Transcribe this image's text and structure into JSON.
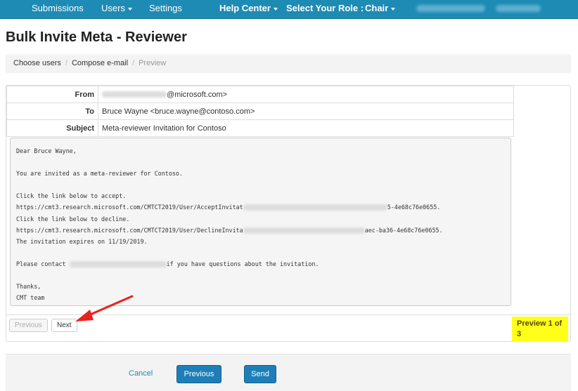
{
  "nav": {
    "submissions": "Submissions",
    "users": "Users",
    "settings": "Settings",
    "help_center": "Help Center",
    "role_label": "Select Your Role :",
    "role_value": "Chair"
  },
  "page": {
    "title": "Bulk Invite Meta - Reviewer"
  },
  "breadcrumb": {
    "step1": "Choose users",
    "step2": "Compose e-mail",
    "step3": "Preview"
  },
  "email": {
    "from_label": "From",
    "from_value": "@microsoft.com>",
    "to_label": "To",
    "to_value": "Bruce Wayne <bruce.wayne@contoso.com>",
    "subject_label": "Subject",
    "subject_value": "Meta-reviewer Invitation for Contoso",
    "body": {
      "l1": "Dear Bruce Wayne,",
      "l2": "You are invited as a meta-reviewer for Contoso.",
      "l3": "Click the link below to accept.",
      "l4a": "https://cmt3.research.microsoft.com/CMTCT2019/User/AcceptInvitat",
      "l4b": "5-4e68c76e0655.",
      "l5": "Click the link below to decline.",
      "l6a": "https://cmt3.research.microsoft.com/CMTCT2019/User/DeclineInvita",
      "l6b": "aec-ba36-4e68c76e0655.",
      "l7": "The invitation expires on 11/19/2019.",
      "l8a": "Please contact ",
      "l8b": "if you have questions about the invitation.",
      "l9": "Thanks,",
      "l10": "CMT team"
    }
  },
  "pager": {
    "previous": "Previous",
    "next": "Next",
    "preview_status": "Preview 1 of 3"
  },
  "footer": {
    "cancel": "Cancel",
    "previous": "Previous",
    "send": "Send"
  },
  "colors": {
    "nav": "#1e8bb4",
    "primary": "#1e7fb8",
    "highlight": "#ffff1a",
    "arrow": "#e8231f"
  }
}
